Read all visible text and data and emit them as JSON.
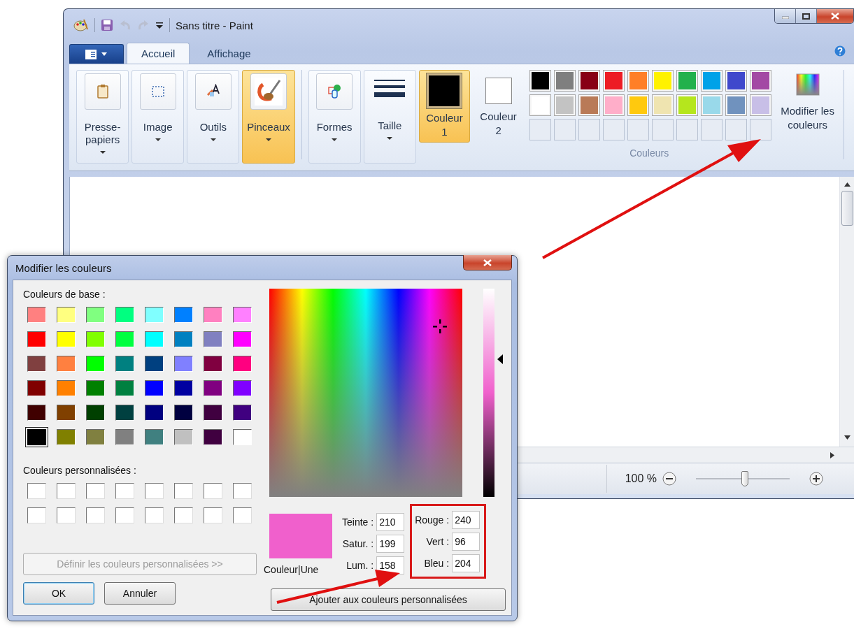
{
  "paint": {
    "title": "Sans titre - Paint",
    "tabs": [
      {
        "label": "Accueil",
        "selected": true
      },
      {
        "label": "Affichage",
        "selected": false
      }
    ],
    "tools": [
      {
        "kind": "clipboard",
        "label": "Presse-papiers",
        "selected": false
      },
      {
        "kind": "image",
        "label": "Image",
        "selected": false
      },
      {
        "kind": "tools",
        "label": "Outils",
        "selected": false
      },
      {
        "kind": "brushes",
        "label": "Pinceaux",
        "selected": true
      },
      {
        "kind": "shapes",
        "label": "Formes",
        "selected": false
      },
      {
        "kind": "size",
        "label": "Taille",
        "selected": false
      }
    ],
    "color_buttons": [
      {
        "label": "Couleur 1",
        "color": "#000000",
        "selected": true
      },
      {
        "label": "Couleur 2",
        "color": "#ffffff",
        "selected": false
      }
    ],
    "palette": [
      {
        "kind": "swatch",
        "color": "#000000"
      },
      {
        "kind": "swatch",
        "color": "#7f7f7f"
      },
      {
        "kind": "swatch",
        "color": "#880015"
      },
      {
        "kind": "swatch",
        "color": "#ed1c24"
      },
      {
        "kind": "swatch",
        "color": "#ff7f27"
      },
      {
        "kind": "swatch",
        "color": "#fff200"
      },
      {
        "kind": "swatch",
        "color": "#22b14c"
      },
      {
        "kind": "swatch",
        "color": "#00a2e8"
      },
      {
        "kind": "swatch",
        "color": "#3f48cc"
      },
      {
        "kind": "swatch",
        "color": "#a349a4"
      },
      {
        "kind": "swatch",
        "color": "#ffffff"
      },
      {
        "kind": "swatch",
        "color": "#c3c3c3"
      },
      {
        "kind": "swatch",
        "color": "#b97a57"
      },
      {
        "kind": "swatch",
        "color": "#ffaec9"
      },
      {
        "kind": "swatch",
        "color": "#ffc90e"
      },
      {
        "kind": "swatch",
        "color": "#efe4b0"
      },
      {
        "kind": "swatch",
        "color": "#b5e61d"
      },
      {
        "kind": "swatch",
        "color": "#99d9ea"
      },
      {
        "kind": "swatch",
        "color": "#7092be"
      },
      {
        "kind": "swatch",
        "color": "#c8bfe7"
      },
      {
        "kind": "empty"
      },
      {
        "kind": "empty"
      },
      {
        "kind": "empty"
      },
      {
        "kind": "empty"
      },
      {
        "kind": "empty"
      },
      {
        "kind": "empty"
      },
      {
        "kind": "empty"
      },
      {
        "kind": "empty"
      },
      {
        "kind": "empty"
      },
      {
        "kind": "empty"
      }
    ],
    "colors_group_label": "Couleurs",
    "edit_colors_button": "Modifier les couleurs",
    "zoom": {
      "reading": "100 %",
      "level": 0.52
    }
  },
  "dialog": {
    "title": "Modifier les couleurs",
    "basic_label": "Couleurs de base :",
    "basic_colors": [
      {
        "color": "#ff8080",
        "selected": false
      },
      {
        "color": "#ffff80",
        "selected": false
      },
      {
        "color": "#80ff80",
        "selected": false
      },
      {
        "color": "#00ff80",
        "selected": false
      },
      {
        "color": "#80ffff",
        "selected": false
      },
      {
        "color": "#0080ff",
        "selected": false
      },
      {
        "color": "#ff80c0",
        "selected": false
      },
      {
        "color": "#ff80ff",
        "selected": false
      },
      {
        "color": "#ff0000",
        "selected": false
      },
      {
        "color": "#ffff00",
        "selected": false
      },
      {
        "color": "#80ff00",
        "selected": false
      },
      {
        "color": "#00ff40",
        "selected": false
      },
      {
        "color": "#00ffff",
        "selected": false
      },
      {
        "color": "#0080c0",
        "selected": false
      },
      {
        "color": "#8080c0",
        "selected": false
      },
      {
        "color": "#ff00ff",
        "selected": false
      },
      {
        "color": "#804040",
        "selected": false
      },
      {
        "color": "#ff8040",
        "selected": false
      },
      {
        "color": "#00ff00",
        "selected": false
      },
      {
        "color": "#008080",
        "selected": false
      },
      {
        "color": "#004080",
        "selected": false
      },
      {
        "color": "#8080ff",
        "selected": false
      },
      {
        "color": "#800040",
        "selected": false
      },
      {
        "color": "#ff0080",
        "selected": false
      },
      {
        "color": "#800000",
        "selected": false
      },
      {
        "color": "#ff8000",
        "selected": false
      },
      {
        "color": "#008000",
        "selected": false
      },
      {
        "color": "#008040",
        "selected": false
      },
      {
        "color": "#0000ff",
        "selected": false
      },
      {
        "color": "#0000a0",
        "selected": false
      },
      {
        "color": "#800080",
        "selected": false
      },
      {
        "color": "#8000ff",
        "selected": false
      },
      {
        "color": "#400000",
        "selected": false
      },
      {
        "color": "#804000",
        "selected": false
      },
      {
        "color": "#004000",
        "selected": false
      },
      {
        "color": "#004040",
        "selected": false
      },
      {
        "color": "#000080",
        "selected": false
      },
      {
        "color": "#000040",
        "selected": false
      },
      {
        "color": "#400040",
        "selected": false
      },
      {
        "color": "#400080",
        "selected": false
      },
      {
        "color": "#000000",
        "selected": true
      },
      {
        "color": "#808000",
        "selected": false
      },
      {
        "color": "#808040",
        "selected": false
      },
      {
        "color": "#808080",
        "selected": false
      },
      {
        "color": "#408080",
        "selected": false
      },
      {
        "color": "#c0c0c0",
        "selected": false
      },
      {
        "color": "#400040",
        "selected": false
      },
      {
        "color": "#ffffff",
        "selected": false
      }
    ],
    "custom_label": "Couleurs personnalisées :",
    "custom_colors": [
      {
        "color": "#ffffff"
      },
      {
        "color": "#ffffff"
      },
      {
        "color": "#ffffff"
      },
      {
        "color": "#ffffff"
      },
      {
        "color": "#ffffff"
      },
      {
        "color": "#ffffff"
      },
      {
        "color": "#ffffff"
      },
      {
        "color": "#ffffff"
      },
      {
        "color": "#ffffff"
      },
      {
        "color": "#ffffff"
      },
      {
        "color": "#ffffff"
      },
      {
        "color": "#ffffff"
      },
      {
        "color": "#ffffff"
      },
      {
        "color": "#ffffff"
      },
      {
        "color": "#ffffff"
      },
      {
        "color": "#ffffff"
      }
    ],
    "define_button": {
      "label": "Définir les couleurs personnalisées >>",
      "disabled": true
    },
    "ok_button": "OK",
    "cancel_button": "Annuler",
    "luminosity": {
      "level": 0.66
    },
    "preview": {
      "color": "#f060cc",
      "label": "Couleur|Une"
    },
    "hsl_fields": [
      {
        "label": "Teinte :",
        "value": "210"
      },
      {
        "label": "Satur. :",
        "value": "199"
      },
      {
        "label": "Lum. :",
        "value": "158"
      }
    ],
    "rgb_fields": [
      {
        "label": "Rouge :",
        "value": "240"
      },
      {
        "label": "Vert :",
        "value": "96"
      },
      {
        "label": "Bleu :",
        "value": "204"
      }
    ],
    "add_button": "Ajouter aux couleurs personnalisées"
  }
}
